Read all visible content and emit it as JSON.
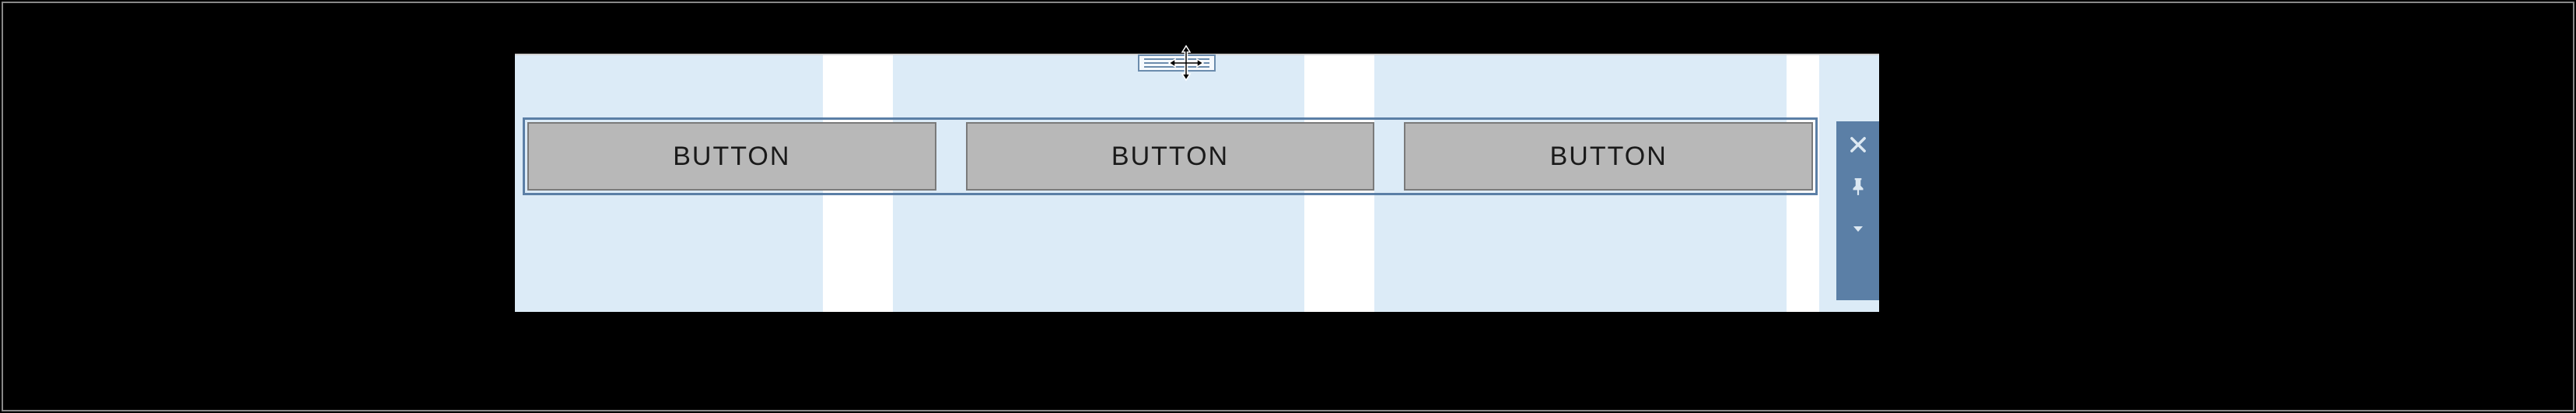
{
  "buttons": {
    "button1": {
      "label": "BUTTON"
    },
    "button2": {
      "label": "BUTTON"
    },
    "button3": {
      "label": "BUTTON"
    }
  },
  "smartTag": {
    "close": "close",
    "pin": "pin",
    "menu": "menu"
  },
  "handle": {
    "type": "move"
  }
}
